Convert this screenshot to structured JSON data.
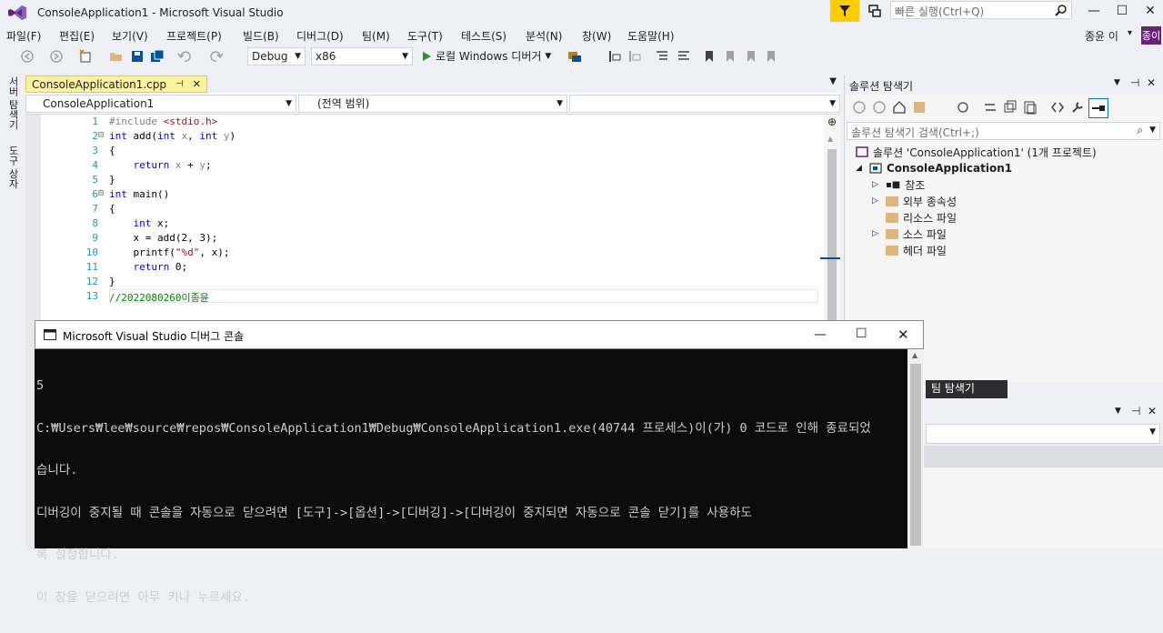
{
  "window": {
    "title": "ConsoleApplication1 - Microsoft Visual Studio",
    "quick_launch_placeholder": "빠른 실행(Ctrl+Q)",
    "min": "—",
    "max": "☐",
    "close": "✕"
  },
  "menu": [
    "파일(F)",
    "편집(E)",
    "보기(V)",
    "프로젝트(P)",
    "빌드(B)",
    "디버그(D)",
    "팀(M)",
    "도구(T)",
    "테스트(S)",
    "분석(N)",
    "창(W)",
    "도움말(H)"
  ],
  "user": {
    "name": "종윤 이",
    "avatar": "종이"
  },
  "toolbar": {
    "config": "Debug",
    "platform": "x86",
    "run_label": "로컬 Windows 디버거"
  },
  "left_tabs": [
    "서버 탐색기",
    "도구 상자"
  ],
  "editor": {
    "tab_label": "ConsoleApplication1.cpp",
    "tab_pin": "⊣",
    "tab_close": "✕",
    "nav_project": "ConsoleApplication1",
    "nav_scope": "(전역 범위)",
    "nav_member": ""
  },
  "code_lines": [
    {
      "n": "1",
      "html": "<span class=\"pp\">#include</span> <span class=\"str\">&lt;stdio.h&gt;</span>"
    },
    {
      "n": "2",
      "html": "<span class=\"kw\">int</span> add(<span class=\"kw\">int</span> <span class=\"param\">x</span>, <span class=\"kw\">int</span> <span class=\"param\">y</span>)"
    },
    {
      "n": "3",
      "html": "{"
    },
    {
      "n": "4",
      "html": "    <span class=\"kw\">return</span> <span class=\"param\">x</span> + <span class=\"param\">y</span>;"
    },
    {
      "n": "5",
      "html": "}"
    },
    {
      "n": "6",
      "html": "<span class=\"kw\">int</span> main()"
    },
    {
      "n": "7",
      "html": "{"
    },
    {
      "n": "8",
      "html": "    <span class=\"kw\">int</span> x;"
    },
    {
      "n": "9",
      "html": "    x = add(2, 3);"
    },
    {
      "n": "10",
      "html": "    printf(<span class=\"str\">\"%d\"</span>, x);"
    },
    {
      "n": "11",
      "html": "    <span class=\"kw\">return</span> 0;"
    },
    {
      "n": "12",
      "html": "}"
    },
    {
      "n": "13",
      "html": "<span class=\"cm\">//2022080260이종윤</span>"
    }
  ],
  "solution": {
    "title": "솔루션 탐색기",
    "search_placeholder": "솔루션 탐색기 검색(Ctrl+;)",
    "root": "솔루션 'ConsoleApplication1' (1개 프로젝트)",
    "project": "ConsoleApplication1",
    "items": [
      "참조",
      "외부 종속성",
      "리소스 파일",
      "소스 파일",
      "헤더 파일"
    ]
  },
  "team_tab": "팀 탐색기",
  "console": {
    "title": "Microsoft Visual Studio 디버그 콘솔",
    "lines": [
      "5",
      "C:₩Users₩lee₩source₩repos₩ConsoleApplication1₩Debug₩ConsoleApplication1.exe(40744 프로세스)이(가) 0 코드로 인해 종료되었",
      "습니다.",
      "디버깅이 중지될 때 콘솔을 자동으로 닫으려면 [도구]->[옵션]->[디버깅]->[디버깅이 중지되면 자동으로 콘솔 닫기]를 사용하도",
      "록 설정합니다.",
      "이 창을 닫으려면 아무 키나 누르세요."
    ]
  }
}
